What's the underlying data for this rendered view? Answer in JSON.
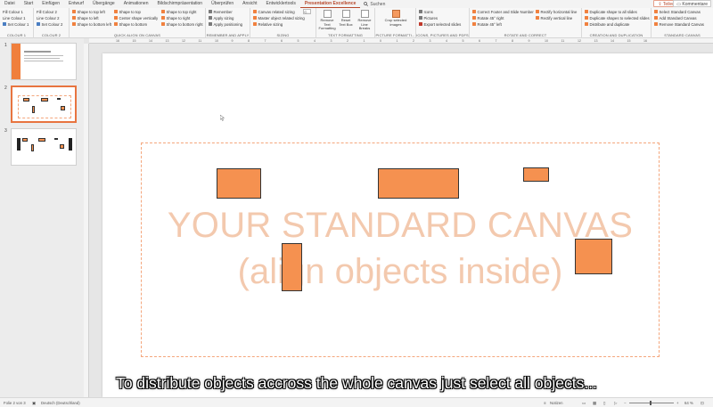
{
  "tabs": [
    "Datei",
    "Start",
    "Einfügen",
    "Entwurf",
    "Übergänge",
    "Animationen",
    "Bildschirmpräsentation",
    "Überprüfen",
    "Ansicht",
    "Entwicklertools",
    "Presentation Excellence"
  ],
  "search_label": "Suchen",
  "share_label": "Teilen",
  "comments_label": "Kommentare",
  "ribbon": {
    "colour1": {
      "items": [
        "Fill Colour 1",
        "Line Colour 1",
        "Set Colour 1"
      ],
      "label": "COLOUR 1"
    },
    "colour2": {
      "items": [
        "Fill Colour 2",
        "Line Colour 2",
        "Set Colour 2"
      ],
      "label": "COLOUR 2"
    },
    "align": {
      "col1": [
        "Shape to top left",
        "Shape to left",
        "Shape to bottom left"
      ],
      "col2": [
        "Shape to top",
        "Center shape vertically",
        "Shape to bottom"
      ],
      "col3": [
        "Shape to top right",
        "Shape to right",
        "Shape to bottom right"
      ],
      "label": "QUICK ALIGN ON CANVAS"
    },
    "remember": {
      "items": [
        "Remember",
        "Apply sizing",
        "Apply positioning"
      ],
      "label": "REMEMBER AND APPLY"
    },
    "sizing": {
      "items": [
        "Canvas related sizing",
        "Master object related sizing",
        "Relative sizing"
      ],
      "box_value": "C...",
      "label": "SIZING"
    },
    "textformat": {
      "buttons": [
        "Remove Text Formatting",
        "Reset Text Box",
        "Remove Line Breaks"
      ],
      "label": "TEXT FORMATTING"
    },
    "picture": {
      "button": "Crop selected images",
      "label": "PICTURE FORMATTI..."
    },
    "icons": {
      "items": [
        "Icons",
        "Pictures",
        "Export selected slides"
      ],
      "label": "ICONS, PICTURES AND PDFS"
    },
    "rotate": {
      "col1": [
        "Correct Footer and Slide Number",
        "Rotate 45° right",
        "Rotate 45° left"
      ],
      "col2": [
        "Rectify horizontal line",
        "Rectify vertical line"
      ],
      "label": "ROTATE AND CORRECT"
    },
    "creation": {
      "items": [
        "Duplicate shape to all slides",
        "Duplicate shapes to selected slides",
        "Distribute and duplicate"
      ],
      "label": "CREATION AND DUPLICATION"
    },
    "standard": {
      "items": [
        "Select Standard Canvas",
        "Add Standard Canvas",
        "Remove Standard Canvas"
      ],
      "label": "STANDARD CANVAS"
    }
  },
  "ruler_numbers": [
    "16",
    "15",
    "14",
    "13",
    "12",
    "11",
    "10",
    "9",
    "8",
    "7",
    "6",
    "5",
    "4",
    "3",
    "2",
    "1",
    "0",
    "1",
    "2",
    "3",
    "4",
    "5",
    "6",
    "7",
    "8",
    "9",
    "10",
    "11",
    "12",
    "13",
    "14",
    "15",
    "16"
  ],
  "thumbnails": [
    "1",
    "2",
    "3"
  ],
  "canvas": {
    "line1": "YOUR STANDARD CANVAS",
    "line2": "(align objects inside)"
  },
  "status": {
    "slide": "Folie 2 von 3",
    "language": "Deutsch (Deutschland)",
    "notes": "Notizen",
    "zoom": "64 %"
  },
  "subtitle": "To distribute objects accross the whole canvas just select all objects...",
  "colors": {
    "accent": "#b7472a",
    "shape_fill": "#f59150",
    "canvas_text": "#f3c9ae",
    "canvas_border": "#f4a67c"
  }
}
